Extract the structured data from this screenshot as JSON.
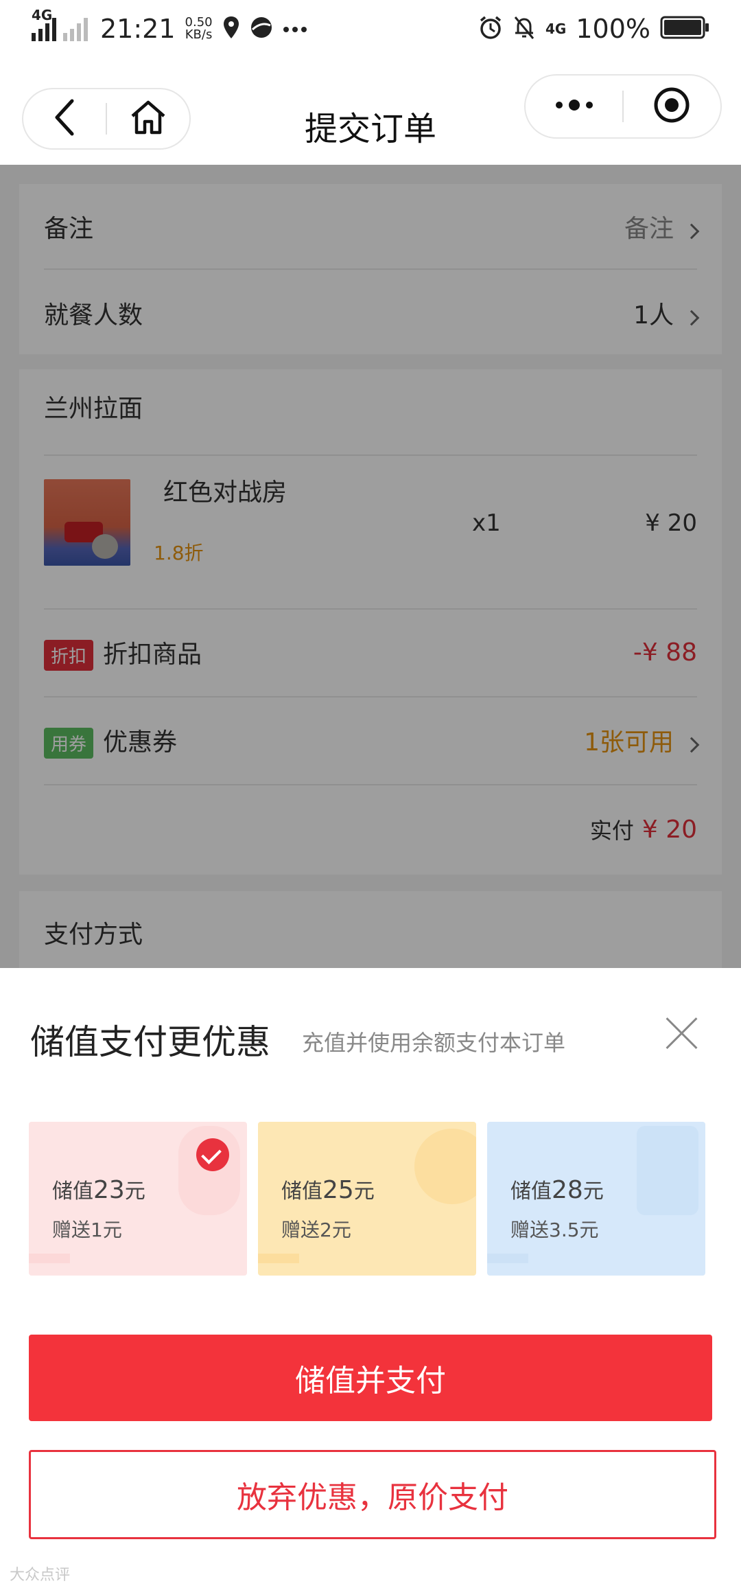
{
  "status_bar": {
    "network_left": "4G",
    "time": "21:21",
    "speed_value": "0.50",
    "speed_unit": "KB/s",
    "network_right": "4G",
    "battery": "100%",
    "icons": [
      "signal-icon",
      "location-icon",
      "browser-icon",
      "more-icon",
      "alarm-icon",
      "mute-icon",
      "battery-icon"
    ]
  },
  "nav": {
    "title": "提交订单",
    "icons": [
      "back-icon",
      "home-icon",
      "menu-dots-icon",
      "target-icon"
    ]
  },
  "order": {
    "remark_label": "备注",
    "remark_value": "备注",
    "diners_label": "就餐人数",
    "diners_value": "1人",
    "shop_name": "兰州拉面",
    "item": {
      "name": "红色对战房",
      "discount": "1.8折",
      "qty": "x1",
      "price": "¥ 20"
    },
    "discount_tag": "折扣",
    "discount_label": "折扣商品",
    "discount_value": "-¥ 88",
    "coupon_tag": "用券",
    "coupon_label": "优惠券",
    "coupon_value": "1张可用",
    "paid_label": "实付",
    "paid_value": "¥ 20",
    "payment_method_label": "支付方式"
  },
  "sheet": {
    "title": "储值支付更优惠",
    "subtitle": "充值并使用余额支付本订单",
    "plans": [
      {
        "prefix": "储值",
        "amount": "23",
        "unit": "元",
        "gift": "赠送1元",
        "selected": true
      },
      {
        "prefix": "储值",
        "amount": "25",
        "unit": "元",
        "gift": "赠送2元",
        "selected": false
      },
      {
        "prefix": "储值",
        "amount": "28",
        "unit": "元",
        "gift": "赠送3.5元",
        "selected": false
      }
    ],
    "primary_button": "储值并支付",
    "secondary_button": "放弃优惠，原价支付",
    "watermark": "大众点评"
  },
  "colors": {
    "accent_red": "#f3333b",
    "discount_orange": "#e59412",
    "coupon_green": "#5cbd62"
  }
}
